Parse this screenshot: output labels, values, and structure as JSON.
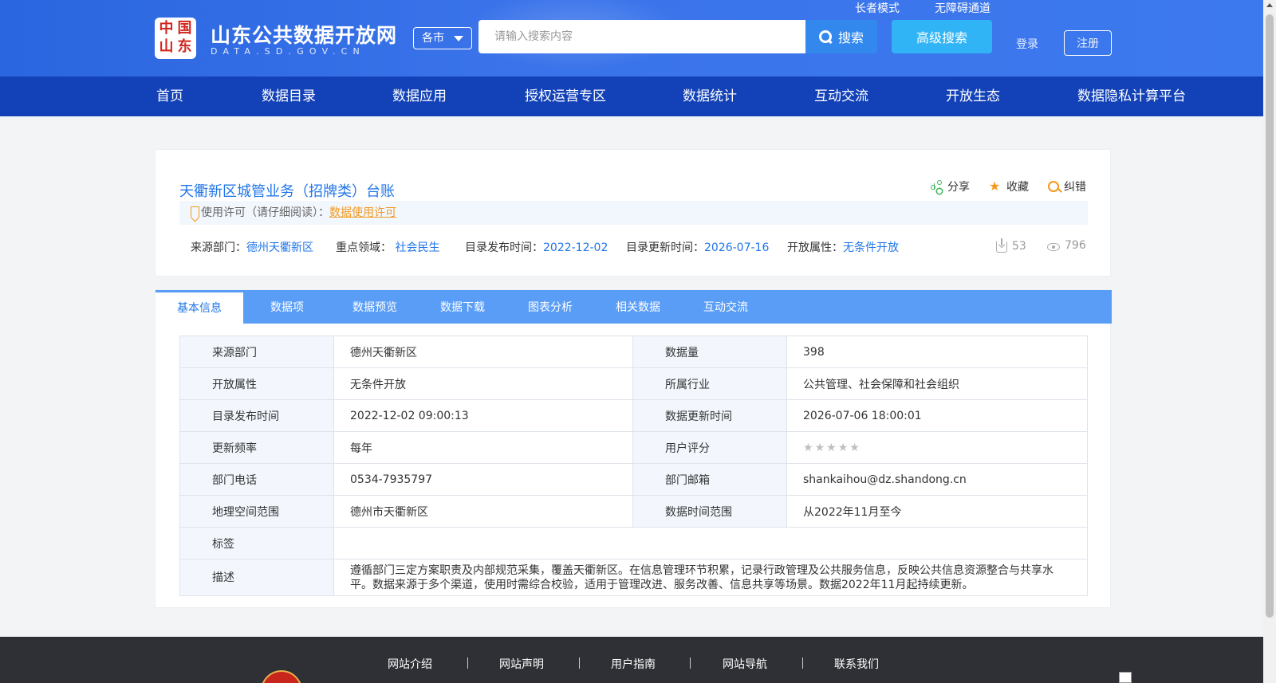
{
  "header": {
    "logo_seal_chars": [
      "中",
      "国",
      "山",
      "东"
    ],
    "site_title": "山东公共数据开放网",
    "site_domain": "DATA.SD.GOV.CN",
    "city_select": "各市",
    "search_placeholder": "请输入搜索内容",
    "search_label": "搜索",
    "advanced_search_label": "高级搜索",
    "elder_mode": "长者模式",
    "accessibility": "无障碍通道",
    "login": "登录",
    "register": "注册"
  },
  "nav": [
    "首页",
    "数据目录",
    "数据应用",
    "授权运营专区",
    "数据统计",
    "互动交流",
    "开放生态",
    "数据隐私计算平台"
  ],
  "dataset": {
    "title": "天衢新区城管业务（招牌类）台账",
    "actions": {
      "share": "分享",
      "favorite": "收藏",
      "report": "纠错"
    },
    "license_prefix": "使用许可（请仔细阅读）：",
    "license_link": "数据使用许可",
    "meta": {
      "source_label": "来源部门：",
      "source": "德州天衢新区",
      "domain_label": "重点领域：",
      "domain": "社会民生",
      "publish_label": "目录发布时间：",
      "publish": "2022-12-02",
      "update_label": "目录更新时间：",
      "update": "2026-07-16",
      "open_label": "开放属性：",
      "open": "无条件开放"
    },
    "downloads": "53",
    "views": "796"
  },
  "tabs": [
    "基本信息",
    "数据项",
    "数据预览",
    "数据下载",
    "图表分析",
    "相关数据",
    "互动交流"
  ],
  "info": {
    "rows": [
      [
        "来源部门",
        "德州天衢新区",
        "数据量",
        "398"
      ],
      [
        "开放属性",
        "无条件开放",
        "所属行业",
        "公共管理、社会保障和社会组织"
      ],
      [
        "目录发布时间",
        "2022-12-02 09:00:13",
        "数据更新时间",
        "2026-07-06 18:00:01"
      ],
      [
        "更新频率",
        "每年",
        "用户评分",
        ""
      ],
      [
        "部门电话",
        "0534-7935797",
        "部门邮箱",
        "shankaihou@dz.shandong.cn"
      ],
      [
        "地理空间范围",
        "德州市天衢新区",
        "数据时间范围",
        "从2022年11月至今"
      ]
    ],
    "rating": 0,
    "tags_label": "标签",
    "tags": "",
    "desc_label": "描述",
    "desc": "遵循部门三定方案职责及内部规范采集，覆盖天衢新区。在信息管理环节积累，记录行政管理及公共服务信息，反映公共信息资源整合与共享水平。数据来源于多个渠道，使用时需综合校验，适用于管理改进、服务改善、信息共享等场景。数据2022年11月起持续更新。"
  },
  "footer": [
    "网站介绍",
    "网站声明",
    "用户指南",
    "网站导航",
    "联系我们"
  ],
  "colors": {
    "header": "#3a73ea",
    "nav": "#1342b8",
    "tabs": "#5a9df7",
    "link": "#2176e8",
    "accent": "#f39a1e",
    "footer": "#2f3035"
  }
}
